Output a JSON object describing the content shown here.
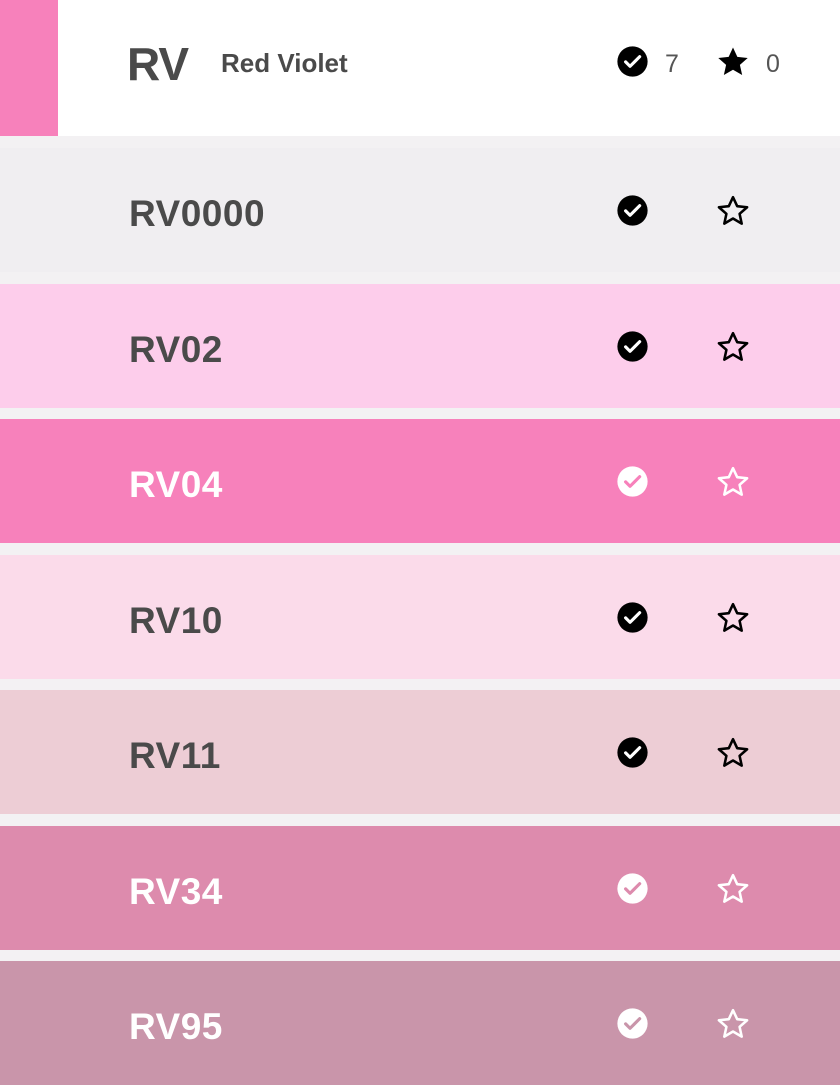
{
  "header": {
    "code": "RV",
    "name": "Red Violet",
    "swatch_color": "#f781bb",
    "owned_count": "7",
    "favorite_count": "0",
    "icons": {
      "owned": "check-circle-icon",
      "favorite": "star-filled-icon"
    }
  },
  "rows": [
    {
      "code": "RV0000",
      "color": "#f0eef1",
      "text_color": "#4a4a4a",
      "owned": true,
      "favorite": false
    },
    {
      "code": "RV02",
      "color": "#fdcdeb",
      "text_color": "#4a4a4a",
      "owned": true,
      "favorite": false
    },
    {
      "code": "RV04",
      "color": "#f781bb",
      "text_color": "#ffffff",
      "owned": true,
      "favorite": false
    },
    {
      "code": "RV10",
      "color": "#fbdbea",
      "text_color": "#4a4a4a",
      "owned": true,
      "favorite": false
    },
    {
      "code": "RV11",
      "color": "#edcdd5",
      "text_color": "#4a4a4a",
      "owned": true,
      "favorite": false
    },
    {
      "code": "RV34",
      "color": "#dd8bad",
      "text_color": "#ffffff",
      "owned": true,
      "favorite": false
    },
    {
      "code": "RV95",
      "color": "#c995aa",
      "text_color": "#ffffff",
      "owned": true,
      "favorite": false
    }
  ]
}
